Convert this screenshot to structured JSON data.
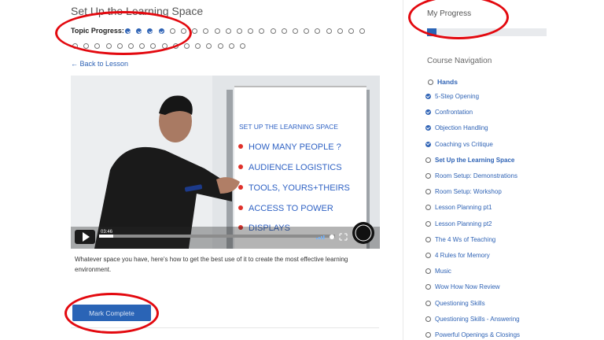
{
  "lesson": {
    "title": "Set Up the Learning Space",
    "progress_label": "Topic Progress:",
    "completed_topics": 4,
    "total_topics": 38,
    "back_link": "← Back to Lesson",
    "description": "Whatever space you have, here's how to get the best use of it to create the most effective learning environment.",
    "mark_complete": "Mark Complete"
  },
  "video": {
    "time": "03:46",
    "whiteboard_lines": [
      "SET UP THE LEARNING SPACE",
      "HOW MANY PEOPLE ?",
      "AUDIENCE LOGISTICS",
      "TOOLS, YOURS+THEIRS",
      "ACCESS TO POWER",
      "DISPLAYS"
    ]
  },
  "sidebar": {
    "my_progress": "My Progress",
    "progress_value": 0.08,
    "course_nav_title": "Course Navigation",
    "section": "Hands",
    "items": [
      {
        "label": "5-Step Opening",
        "status": "done"
      },
      {
        "label": "Confrontation",
        "status": "done"
      },
      {
        "label": "Objection Handling",
        "status": "done"
      },
      {
        "label": "Coaching vs Critique",
        "status": "done"
      },
      {
        "label": "Set Up the Learning Space",
        "status": "current"
      },
      {
        "label": "Room Setup: Demonstrations",
        "status": "todo"
      },
      {
        "label": "Room Setup: Workshop",
        "status": "todo"
      },
      {
        "label": "Lesson Planning pt1",
        "status": "todo"
      },
      {
        "label": "Lesson Planning pt2",
        "status": "todo"
      },
      {
        "label": "The 4 Ws of Teaching",
        "status": "todo"
      },
      {
        "label": "4 Rules for Memory",
        "status": "todo"
      },
      {
        "label": "Music",
        "status": "todo"
      },
      {
        "label": "Wow How Now Review",
        "status": "todo"
      },
      {
        "label": "Questioning Skills",
        "status": "todo"
      },
      {
        "label": "Questioning Skills - Answering",
        "status": "todo"
      },
      {
        "label": "Powerful Openings & Closings",
        "status": "todo"
      }
    ]
  },
  "colors": {
    "accent": "#2f63b5",
    "annotation": "#e3090f"
  }
}
